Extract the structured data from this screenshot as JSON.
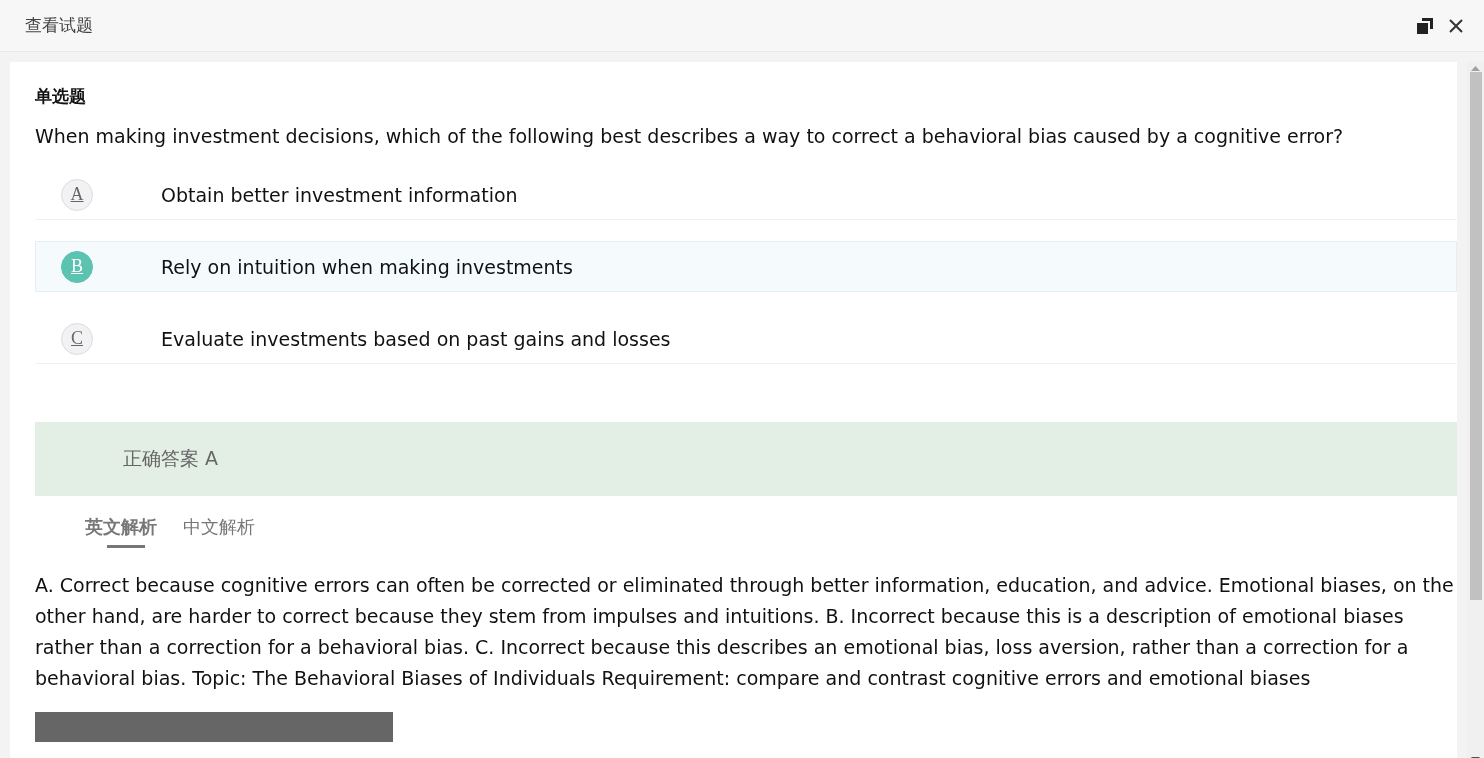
{
  "window": {
    "title": "查看试题"
  },
  "question": {
    "type_label": "单选题",
    "text": "When making investment decisions, which of the following best describes a way to correct a behavioral bias caused by a cognitive error?"
  },
  "options": [
    {
      "letter": "A",
      "text": "Obtain better investment information",
      "selected": false
    },
    {
      "letter": "B",
      "text": "Rely on intuition when making investments",
      "selected": true
    },
    {
      "letter": "C",
      "text": "Evaluate investments based on past gains and losses",
      "selected": false
    }
  ],
  "answer": {
    "text": "正确答案 A"
  },
  "tabs": [
    {
      "label": "英文解析",
      "selected": true
    },
    {
      "label": "中文解析",
      "selected": false
    }
  ],
  "explanation": "A. Correct because cognitive errors can often be corrected or eliminated through better information, education, and advice. Emotional biases, on the other hand, are harder to correct because they stem from impulses and intuitions. B. Incorrect because this is a description of emotional biases rather than a correction for a behavioral bias. C. Incorrect because this describes an emotional bias, loss aversion, rather than a correction for a behavioral bias. Topic: The Behavioral Biases of Individuals Requirement: compare and contrast cognitive errors and emotional biases"
}
